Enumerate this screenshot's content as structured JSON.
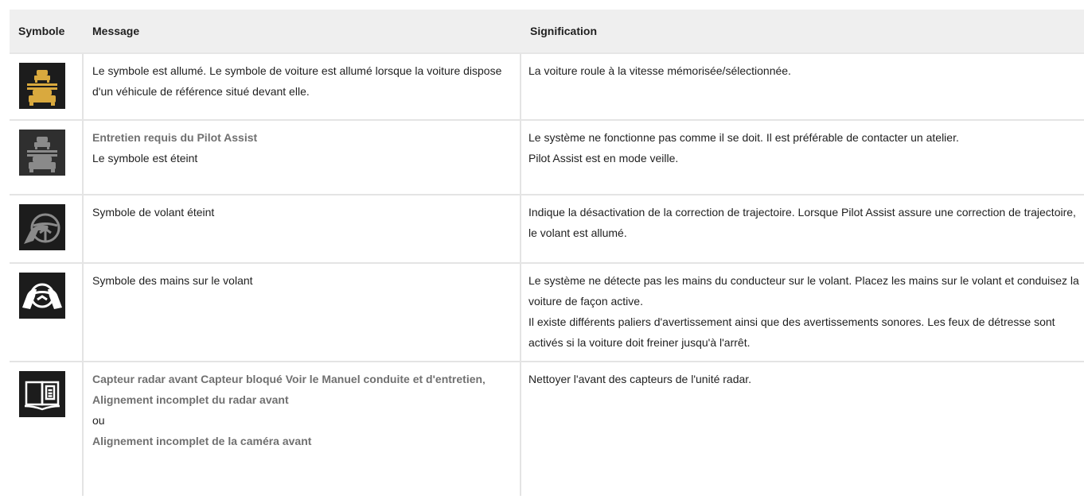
{
  "table": {
    "headers": {
      "symbol": "Symbole",
      "message": "Message",
      "meaning": "Signification"
    },
    "rows": [
      {
        "icon": "car-follow-amber-icon",
        "message": [
          "Le symbole est allumé. Le symbole de voiture est allumé lorsque la voiture dispose d'un véhicule de référence situé devant elle."
        ],
        "meaning": [
          "La voiture roule à la vitesse mémorisée/sélectionnée."
        ]
      },
      {
        "icon": "car-follow-gray-icon",
        "message_title": "Entretien requis du Pilot Assist",
        "message": [
          "Le symbole est éteint"
        ],
        "meaning": [
          "Le système ne fonctionne pas comme il se doit. Il est préférable de contacter un atelier.",
          "Pilot Assist est en mode veille."
        ]
      },
      {
        "icon": "steering-wheel-off-icon",
        "message": [
          "Symbole de volant éteint"
        ],
        "meaning": [
          "Indique la désactivation de la correction de trajectoire. Lorsque Pilot Assist assure une correction de trajectoire, le volant est allumé."
        ]
      },
      {
        "icon": "hands-on-wheel-icon",
        "message": [
          "Symbole des mains sur le volant"
        ],
        "meaning": [
          "Le système ne détecte pas les mains du conducteur sur le volant. Placez les mains sur le volant et conduisez la voiture de façon active.",
          "Il existe différents paliers d'avertissement ainsi que des avertissements sonores. Les feux de détresse sont activés si la voiture doit freiner jusqu'à l'arrêt."
        ]
      },
      {
        "icon": "manual-book-icon",
        "message_title": "Capteur radar avant Capteur bloqué Voir le Manuel conduite et d'entretien",
        "message_sep": ",",
        "message_alt1": "Alignement incomplet du radar avant",
        "message_or": "ou",
        "message_alt2": "Alignement incomplet de la caméra avant",
        "meaning": [
          "Nettoyer l'avant des capteurs de l'unité radar."
        ]
      }
    ]
  },
  "colors": {
    "amber": "#d9a93e",
    "gray_icon": "#8a8a8a",
    "header_bg": "#efefef"
  }
}
